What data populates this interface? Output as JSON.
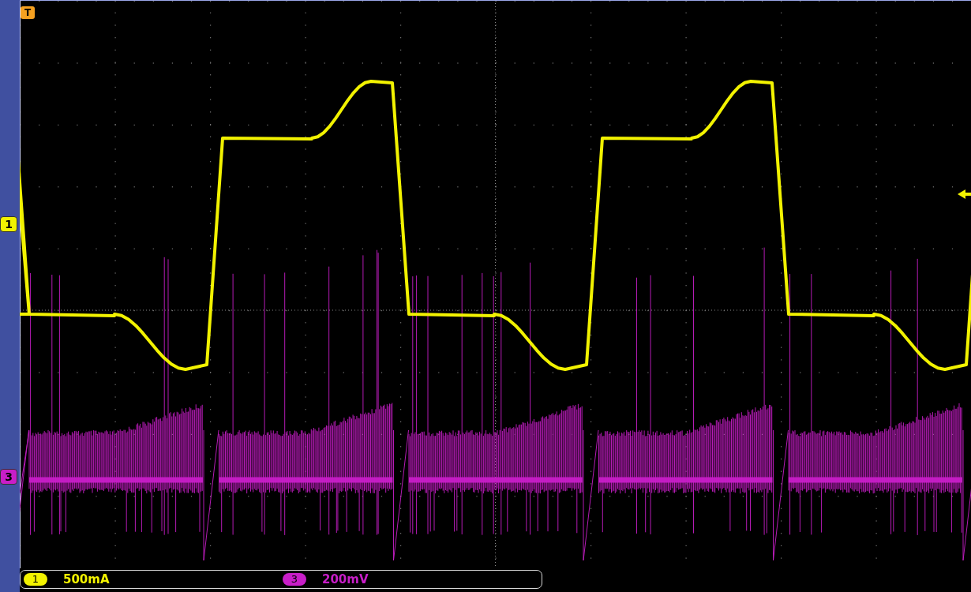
{
  "trigger_marker": {
    "label": "T"
  },
  "channel_markers": [
    {
      "label": "1",
      "color": "#f2f200"
    },
    {
      "label": "3",
      "color": "#c81ec8"
    }
  ],
  "readouts": [
    {
      "channel": "1",
      "scale": "500mA",
      "color": "#f2f200"
    },
    {
      "channel": "3",
      "scale": "200mV",
      "color": "#c81ec8"
    }
  ]
}
